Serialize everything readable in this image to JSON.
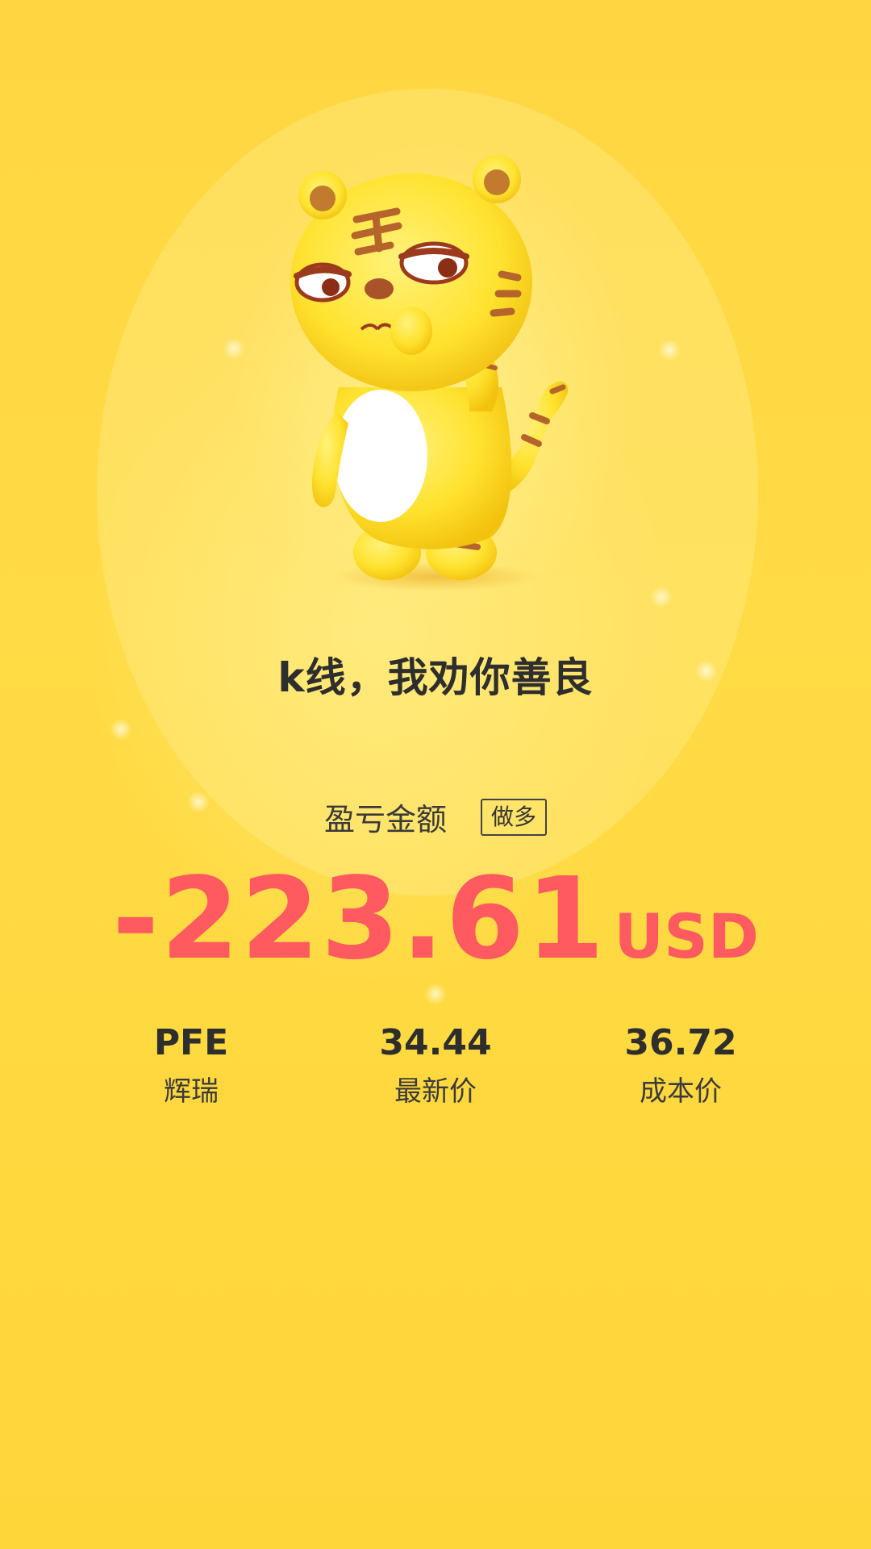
{
  "tagline": "k线，我劝你善良",
  "profit_loss": {
    "label": "盈亏金额",
    "direction_badge": "做多",
    "amount": "-223.61",
    "currency": "USD"
  },
  "stats": [
    {
      "value": "PFE",
      "label": "辉瑞"
    },
    {
      "value": "34.44",
      "label": "最新价"
    },
    {
      "value": "36.72",
      "label": "成本价"
    }
  ],
  "colors": {
    "background": "#FFD93D",
    "loss": "#FF5A5F",
    "text": "#2E2E2E"
  },
  "mascot": {
    "icon": "tiger-mascot-icon"
  }
}
